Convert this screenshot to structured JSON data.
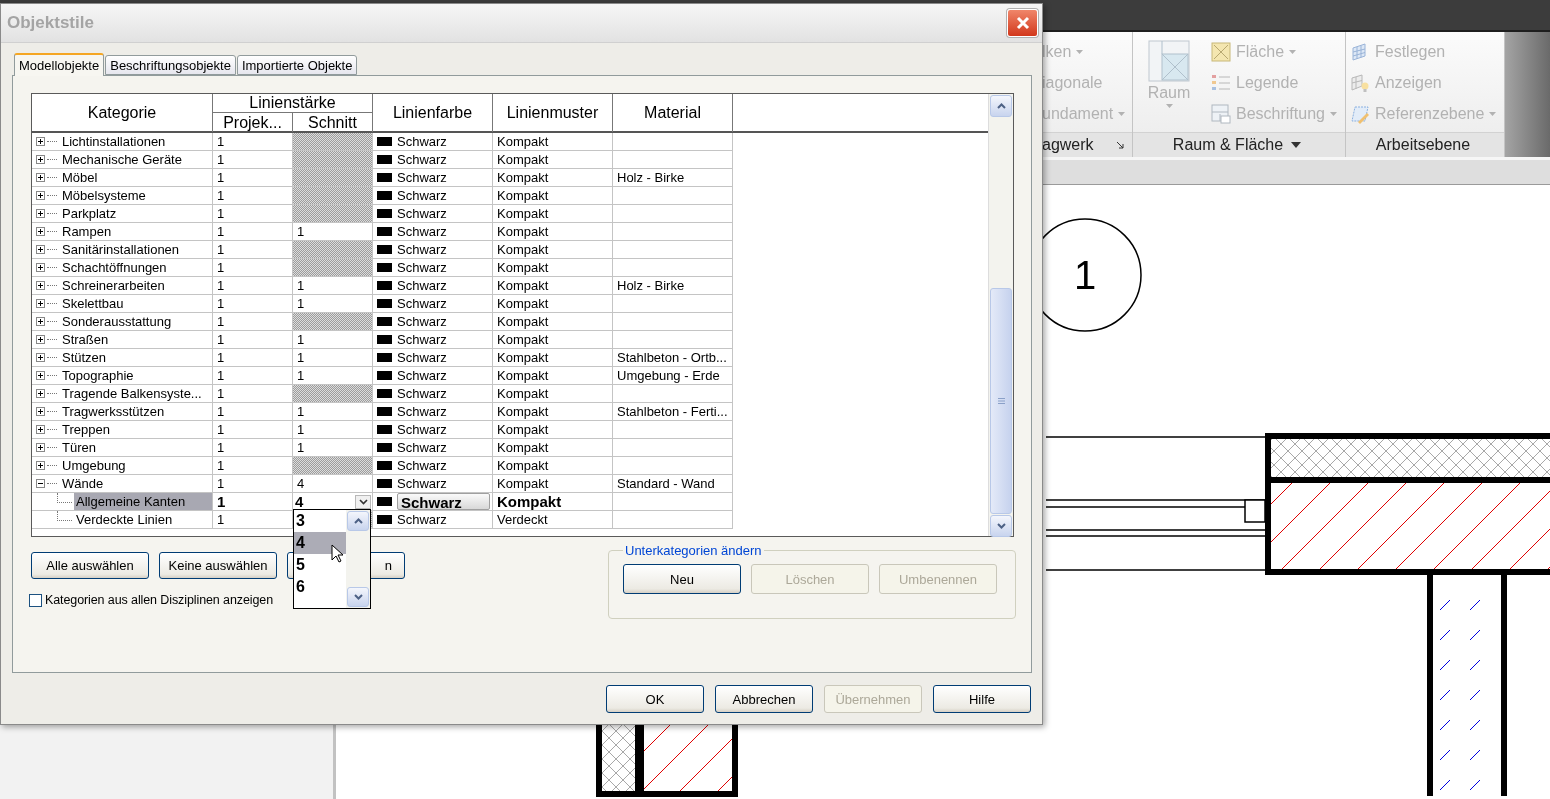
{
  "window": {
    "title": "Objektstile"
  },
  "background": {
    "ribbon_panels": [
      {
        "kind": "partial",
        "title": "agwerk",
        "launcher": true,
        "title_menu": false,
        "items": [
          {
            "label": "lken",
            "dropdown": true
          },
          {
            "label": "iagonale",
            "dropdown": false
          },
          {
            "label": "undament",
            "dropdown": true
          }
        ]
      },
      {
        "kind": "room",
        "title": "Raum & Fläche",
        "launcher": false,
        "title_menu": true,
        "large_button": {
          "label": "Raum"
        },
        "items": [
          {
            "label": "Fläche",
            "dropdown": true
          },
          {
            "label": "Legende",
            "dropdown": false
          },
          {
            "label": "Beschriftung",
            "dropdown": true
          }
        ]
      },
      {
        "kind": "workplane",
        "title": "Arbeitsebene",
        "launcher": false,
        "title_menu": false,
        "items": [
          {
            "label": "Festlegen",
            "dropdown": false
          },
          {
            "label": "Anzeigen",
            "dropdown": false
          },
          {
            "label": "Referenzebene",
            "dropdown": true
          }
        ]
      }
    ],
    "view": {
      "grid_label": "1"
    }
  },
  "tabs": [
    {
      "label": "Modellobjekte",
      "selected": true
    },
    {
      "label": "Beschriftungsobjekte",
      "selected": false
    },
    {
      "label": "Importierte Objekte",
      "selected": false
    }
  ],
  "table": {
    "headers": {
      "category": "Kategorie",
      "line_weight": "Linienstärke",
      "projection": "Projek...",
      "section": "Schnitt",
      "line_color": "Linienfarbe",
      "line_pattern": "Linienmuster",
      "material": "Material"
    },
    "rows": [
      {
        "name": "Lichtinstallationen",
        "projection": "1",
        "line_color": "Schwarz",
        "pattern": "Kompakt",
        "expanded": false,
        "selected": false
      },
      {
        "name": "Mechanische Geräte",
        "projection": "1",
        "line_color": "Schwarz",
        "pattern": "Kompakt",
        "expanded": false,
        "selected": false
      },
      {
        "name": "Möbel",
        "projection": "1",
        "line_color": "Schwarz",
        "pattern": "Kompakt",
        "material": "Holz - Birke",
        "expanded": false,
        "selected": false
      },
      {
        "name": "Möbelsysteme",
        "projection": "1",
        "line_color": "Schwarz",
        "pattern": "Kompakt",
        "expanded": false,
        "selected": false
      },
      {
        "name": "Parkplatz",
        "projection": "1",
        "line_color": "Schwarz",
        "pattern": "Kompakt",
        "expanded": false,
        "selected": false
      },
      {
        "name": "Rampen",
        "projection": "1",
        "section": "1",
        "line_color": "Schwarz",
        "pattern": "Kompakt",
        "expanded": false,
        "selected": false
      },
      {
        "name": "Sanitärinstallationen",
        "projection": "1",
        "line_color": "Schwarz",
        "pattern": "Kompakt",
        "expanded": false,
        "selected": false
      },
      {
        "name": "Schachtöffnungen",
        "projection": "1",
        "line_color": "Schwarz",
        "pattern": "Kompakt",
        "expanded": false,
        "selected": false
      },
      {
        "name": "Schreinerarbeiten",
        "projection": "1",
        "section": "1",
        "line_color": "Schwarz",
        "pattern": "Kompakt",
        "material": "Holz - Birke",
        "expanded": false,
        "selected": false
      },
      {
        "name": "Skelettbau",
        "projection": "1",
        "section": "1",
        "line_color": "Schwarz",
        "pattern": "Kompakt",
        "expanded": false,
        "selected": false
      },
      {
        "name": "Sonderausstattung",
        "projection": "1",
        "line_color": "Schwarz",
        "pattern": "Kompakt",
        "expanded": false,
        "selected": false
      },
      {
        "name": "Straßen",
        "projection": "1",
        "section": "1",
        "line_color": "Schwarz",
        "pattern": "Kompakt",
        "expanded": false,
        "selected": false
      },
      {
        "name": "Stützen",
        "projection": "1",
        "section": "1",
        "line_color": "Schwarz",
        "pattern": "Kompakt",
        "material": "Stahlbeton - Ortb...",
        "expanded": false,
        "selected": false
      },
      {
        "name": "Topographie",
        "projection": "1",
        "section": "1",
        "line_color": "Schwarz",
        "pattern": "Kompakt",
        "material": "Umgebung - Erde",
        "expanded": false,
        "selected": false
      },
      {
        "name": "Tragende Balkensyste...",
        "projection": "1",
        "line_color": "Schwarz",
        "pattern": "Kompakt",
        "expanded": false,
        "selected": false
      },
      {
        "name": "Tragwerksstützen",
        "projection": "1",
        "section": "1",
        "line_color": "Schwarz",
        "pattern": "Kompakt",
        "material": "Stahlbeton - Ferti...",
        "expanded": false,
        "selected": false
      },
      {
        "name": "Treppen",
        "projection": "1",
        "section": "1",
        "line_color": "Schwarz",
        "pattern": "Kompakt",
        "expanded": false,
        "selected": false
      },
      {
        "name": "Türen",
        "projection": "1",
        "section": "1",
        "line_color": "Schwarz",
        "pattern": "Kompakt",
        "expanded": false,
        "selected": false
      },
      {
        "name": "Umgebung",
        "projection": "1",
        "line_color": "Schwarz",
        "pattern": "Kompakt",
        "expanded": false,
        "selected": false
      },
      {
        "name": "Wände",
        "projection": "1",
        "section": "4",
        "line_color": "Schwarz",
        "pattern": "Kompakt",
        "material": "Standard - Wand",
        "expanded": true,
        "selected": false,
        "children": [
          {
            "name": "Allgemeine Kanten",
            "projection": "1",
            "section": "4",
            "line_color": "Schwarz",
            "pattern": "Kompakt",
            "selected": true
          },
          {
            "name": "Verdeckte Linien",
            "projection": "1",
            "line_color": "Schwarz",
            "pattern": "Verdeckt",
            "selected": false
          }
        ]
      }
    ],
    "dropdown": {
      "options": [
        {
          "label": "3",
          "selected": false
        },
        {
          "label": "4",
          "selected": true
        },
        {
          "label": "5",
          "selected": false
        },
        {
          "label": "6",
          "selected": false
        }
      ]
    }
  },
  "buttons": [
    {
      "label": "Alle auswählen",
      "covered": false
    },
    {
      "label": "Keine auswählen",
      "covered": false
    },
    {
      "label": "n",
      "covered": true
    }
  ],
  "show_all_disciplines": {
    "label": "Kategorien aus allen Disziplinen anzeigen",
    "checked": false
  },
  "subcategories": {
    "title": "Unterkategorien ändern",
    "buttons": [
      {
        "label": "Neu",
        "disabled": false
      },
      {
        "label": "Löschen",
        "disabled": true
      },
      {
        "label": "Umbenennen",
        "disabled": true
      }
    ]
  },
  "footer_buttons": [
    {
      "label": "OK",
      "disabled": false
    },
    {
      "label": "Abbrechen",
      "disabled": false
    },
    {
      "label": "Übernehmen",
      "disabled": true
    },
    {
      "label": "Hilfe",
      "disabled": false
    }
  ]
}
